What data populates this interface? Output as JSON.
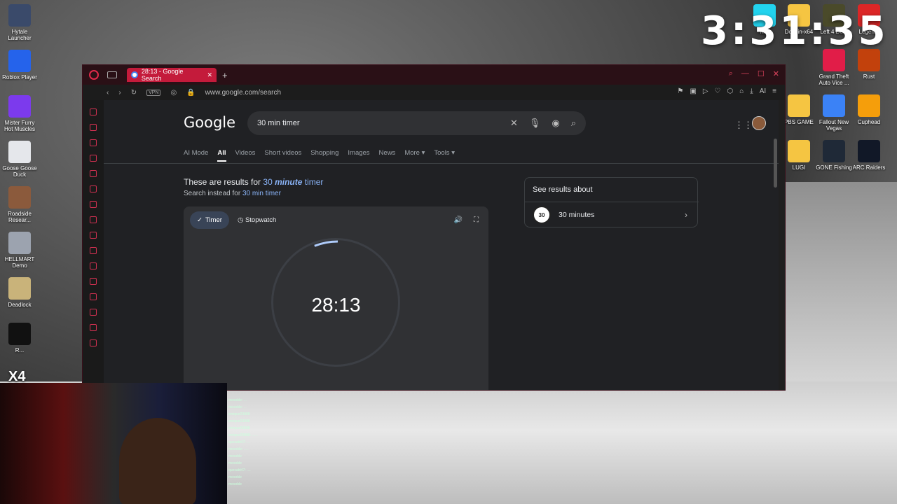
{
  "desktop": {
    "left_icons": [
      {
        "label": "Hytale Launcher",
        "color": "#3a4a6a"
      },
      {
        "label": "Roblox Player",
        "color": "#2563eb"
      },
      {
        "label": "Mister Furry Hot Muscles",
        "color": "#7c3aed"
      },
      {
        "label": "Goose Goose Duck",
        "color": "#e5e7eb"
      },
      {
        "label": "Roadside Resear...",
        "color": "#8b5a3c"
      },
      {
        "label": "HELLMART Demo",
        "color": "#9ca3af"
      },
      {
        "label": "Deadlock",
        "color": "#c9b37a"
      },
      {
        "label": "R...",
        "color": "#111111"
      }
    ],
    "right_icons": [
      {
        "label": "M...",
        "color": "#22d3ee"
      },
      {
        "label": "Dol...in-x64",
        "color": "#f5c542"
      },
      {
        "label": "Left 4 De...",
        "color": "#4a4a2a"
      },
      {
        "label": "Legen...",
        "color": "#dc2626"
      },
      {
        "label": "Grand Theft Auto Vice ...",
        "color": "#e11d48"
      },
      {
        "label": "Rust",
        "color": "#c2410c"
      },
      {
        "label": "PBS GAME",
        "color": "#f5c542"
      },
      {
        "label": "Fallout New Vegas",
        "color": "#3b82f6"
      },
      {
        "label": "Cuphead",
        "color": "#f59e0b"
      },
      {
        "label": "LUGI",
        "color": "#f5c542"
      },
      {
        "label": "GONE Fishing",
        "color": "#1f2937"
      },
      {
        "label": "ARC Raiders",
        "color": "#111827"
      }
    ],
    "clock": "3:31:35"
  },
  "browser": {
    "tab_title": "28:13 - Google Search",
    "url": "www.google.com/search",
    "vpn_label": "VPN",
    "ai_label": "AI"
  },
  "google": {
    "logo": "Google",
    "query": "30 min timer",
    "nav_tabs": [
      "AI Mode",
      "All",
      "Videos",
      "Short videos",
      "Shopping",
      "Images",
      "News",
      "More ▾",
      "Tools ▾"
    ],
    "active_tab": "All",
    "results_for_prefix": "These are results for ",
    "results_for_link_a": "30 ",
    "results_for_link_b": "minute",
    "results_for_link_c": " timer",
    "instead_prefix": "Search instead for ",
    "instead_link": "30 min timer"
  },
  "timer": {
    "mode_timer": "Timer",
    "mode_stopwatch": "Stopwatch",
    "value": "28:13",
    "elapsed_fraction": 0.06
  },
  "knowledge_panel": {
    "title": "See results about",
    "item_label": "30 minutes",
    "item_thumb_text": "30"
  },
  "stream": {
    "webcam_tag": "X4",
    "chat_lines": [
      "mesoble: ...",
      "mesoble: ...",
      "enrique23988",
      "enrique23988",
      "enrique23988",
      "enrique23988: ......",
      "quesabt47: ...",
      "mesoble: .....",
      "mesoble",
      "mesoble",
      "quesabt47: ....",
      "mesoble",
      "mesoble"
    ]
  },
  "colors": {
    "accent": "#c41b3b",
    "link": "#8ab4f8",
    "page_bg": "#202124"
  }
}
